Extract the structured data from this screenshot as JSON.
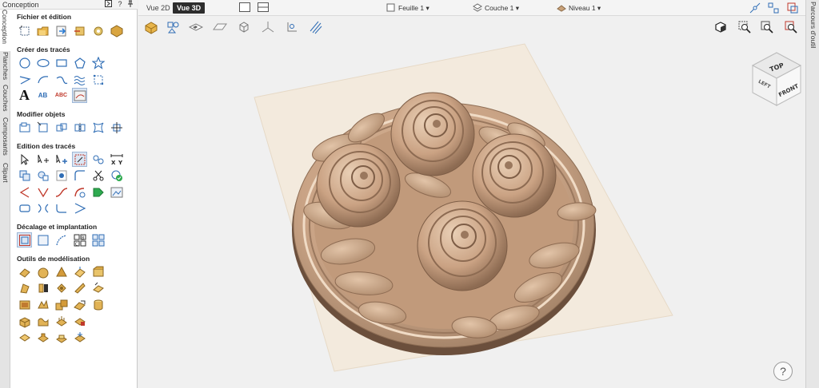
{
  "panel": {
    "title": "Conception"
  },
  "left_tabs": [
    "Conception",
    "Planches",
    "Couches",
    "Composants",
    "Clipart"
  ],
  "right_tab": "Parcours d'outil",
  "sections": {
    "file": "Fichier et édition",
    "create": "Créer des tracés",
    "modify": "Modifier objets",
    "edit": "Edition des tracés",
    "offset": "Décalage et implantation",
    "modeling": "Outils de modélisation"
  },
  "create_text_tools": {
    "text_a": "A",
    "text_ab": "AB",
    "text_abc": "ABC",
    "dim_x": "X",
    "dim_y": "Y"
  },
  "offset_tools": {
    "b": "B",
    "c": "C"
  },
  "view_buttons": {
    "view2d": "Vue 2D",
    "view3d": "Vue 3D"
  },
  "dropdowns": {
    "sheet": "Feuille 1",
    "layer": "Couche 1",
    "level": "Niveau 1"
  },
  "view_cube": {
    "top": "TOP",
    "front": "FRONT",
    "left": "LEFT"
  },
  "help": "?",
  "header_buttons": {
    "help": "?"
  },
  "colors": {
    "accent": "#2d2d2d",
    "wood_light": "#d8b79a",
    "wood_dark": "#9c7a5e",
    "select_blue": "#3a78d4"
  }
}
